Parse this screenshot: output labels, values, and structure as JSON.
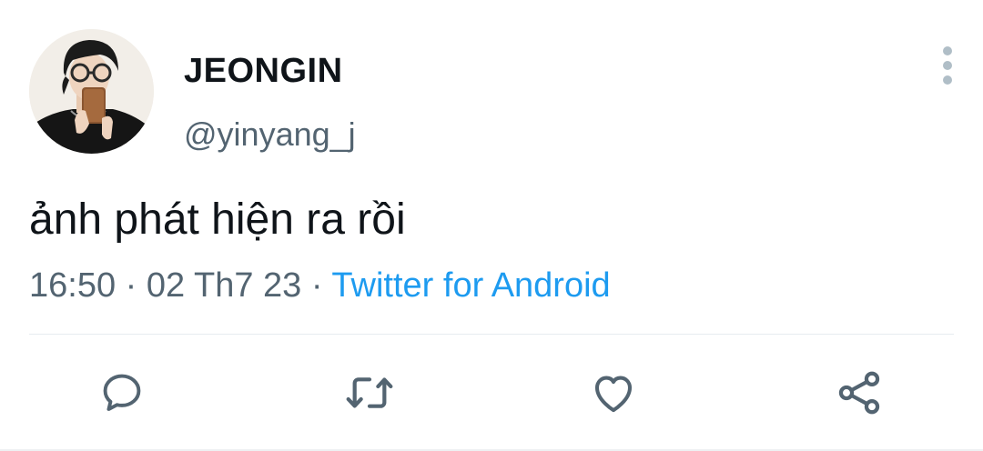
{
  "author": {
    "display_name": "JEONGIN",
    "handle": "@yinyang_j"
  },
  "tweet": {
    "text": "ảnh phát hiện ra rồi",
    "time": "16:50",
    "separator": " · ",
    "date": "02 Th7 23",
    "source": "Twitter for Android"
  },
  "icons": {
    "avatar": "profile-photo",
    "more": "more-vertical-icon",
    "reply": "reply-icon",
    "retweet": "retweet-icon",
    "like": "heart-icon",
    "share": "share-icon"
  },
  "colors": {
    "text": "#0f1419",
    "secondary": "#536471",
    "link": "#1d9bf0",
    "icon": "#536471"
  }
}
